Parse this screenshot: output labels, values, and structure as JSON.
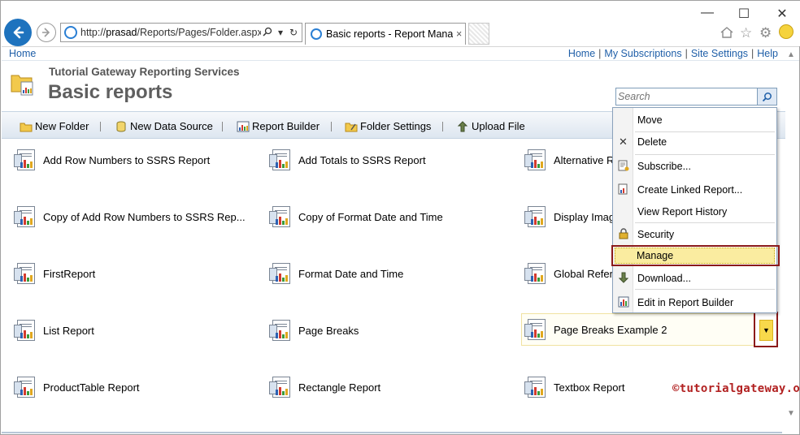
{
  "browser": {
    "address_prefix": "http://",
    "address_host": "prasad",
    "address_path": "/Reports/Pages/Folder.aspx?",
    "tab_title": "Basic reports - Report Mana...",
    "tab_close": "×",
    "minimize": "—",
    "maximize": "☐",
    "close": "✕"
  },
  "linkbar": {
    "home": "Home",
    "right_links": [
      "Home",
      "My Subscriptions",
      "Site Settings",
      "Help"
    ]
  },
  "header": {
    "site_name": "Tutorial Gateway Reporting Services",
    "title": "Basic reports",
    "search_placeholder": "Search"
  },
  "toolbar": {
    "new_folder": "New Folder",
    "new_data_source": "New Data Source",
    "report_builder": "Report Builder",
    "folder_settings": "Folder Settings",
    "upload_file": "Upload File"
  },
  "reports": [
    [
      "Add Row Numbers to SSRS Report",
      "Add Totals to SSRS Report",
      "Alternative R"
    ],
    [
      "Copy of Add Row Numbers to SSRS Rep...",
      "Copy of Format Date and Time",
      "Display Imag"
    ],
    [
      "FirstReport",
      "Format Date and Time",
      "Global Refer"
    ],
    [
      "List Report",
      "Page Breaks",
      "Page Breaks Example 2"
    ],
    [
      "ProductTable Report",
      "Rectangle Report",
      "Textbox Report"
    ]
  ],
  "context_menu": {
    "items": [
      "Move",
      "Delete",
      "Subscribe...",
      "Create Linked Report...",
      "View Report History",
      "Security",
      "Manage",
      "Download...",
      "Edit in Report Builder"
    ],
    "highlighted": "Manage"
  },
  "watermark": "©tutorialgateway.org",
  "colors": {
    "link_blue": "#1f5fa8",
    "highlight_border": "#8b1a1a",
    "highlight_fill": "#faeca0"
  }
}
